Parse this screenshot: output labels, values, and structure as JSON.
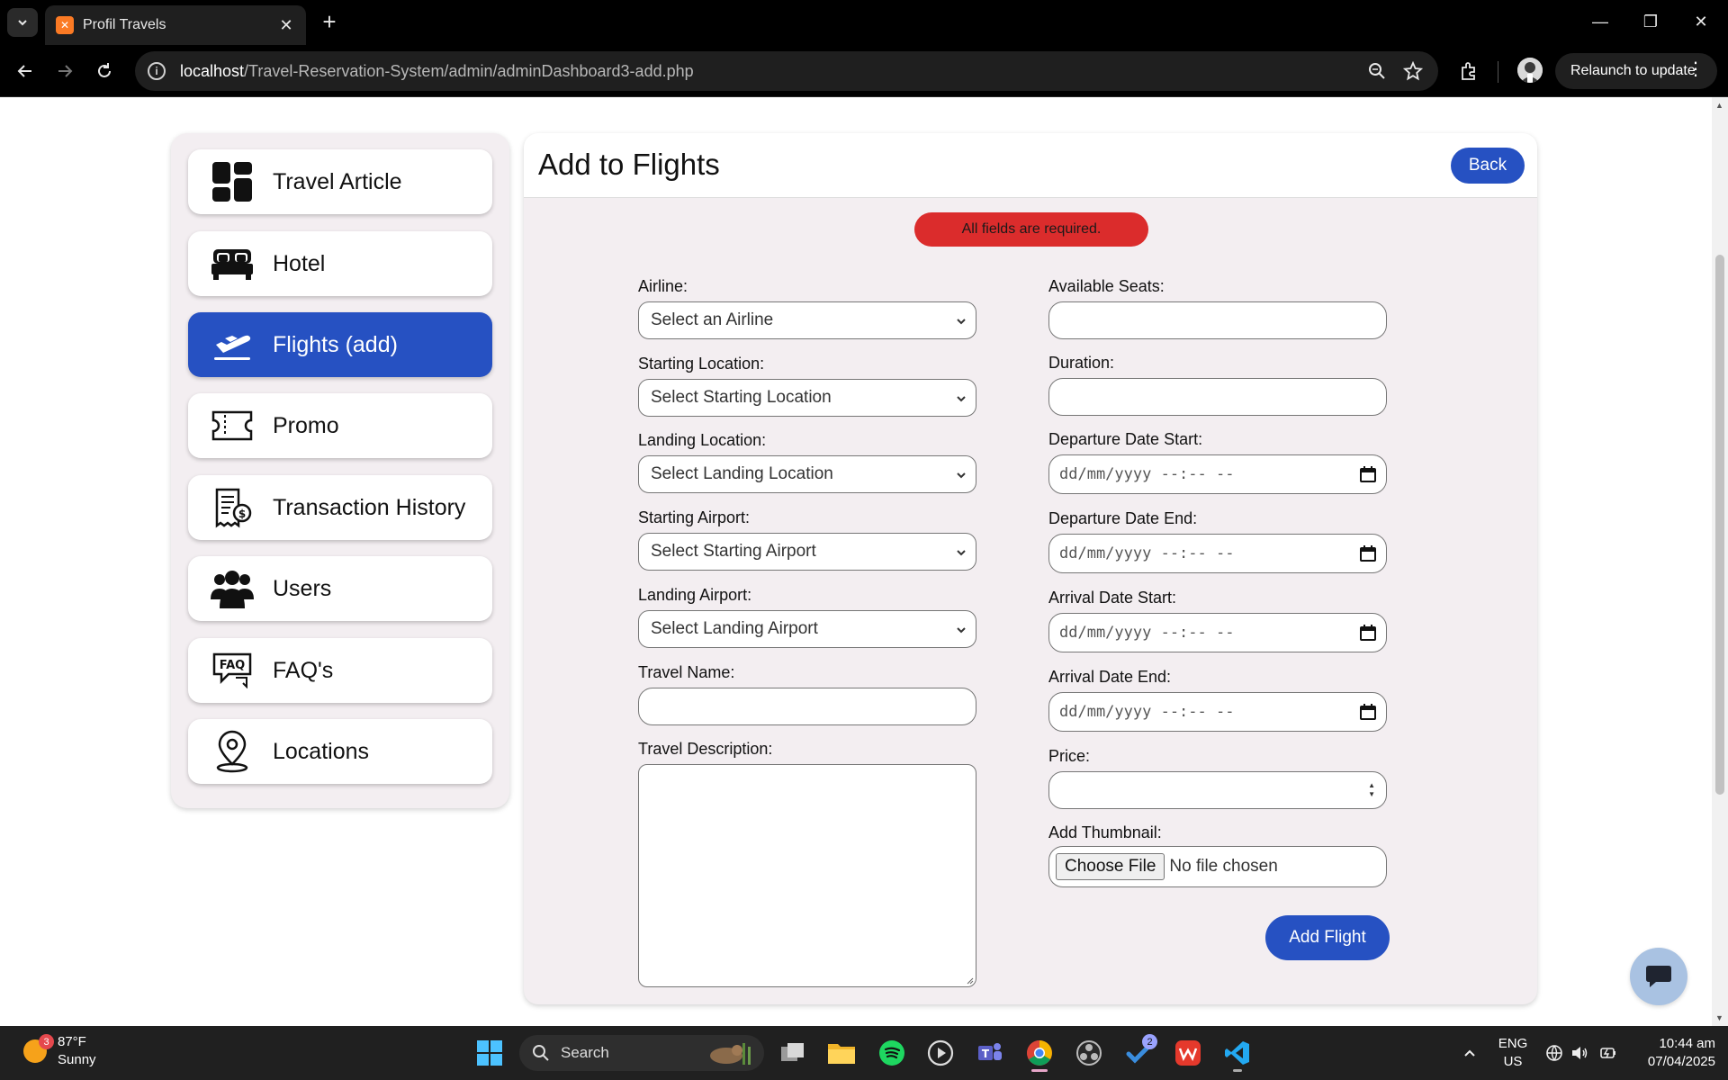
{
  "browser": {
    "tab_title": "Profil Travels",
    "url_host": "localhost",
    "url_path": "/Travel-Reservation-System/admin/adminDashboard3-add.php",
    "relaunch_label": "Relaunch to update"
  },
  "sidebar": {
    "items": [
      {
        "label": "Travel Article",
        "icon": "dashboard-icon"
      },
      {
        "label": "Hotel",
        "icon": "bed-icon"
      },
      {
        "label": "Flights (add)",
        "icon": "plane-departure-icon",
        "active": true
      },
      {
        "label": "Promo",
        "icon": "ticket-icon"
      },
      {
        "label": "Transaction History",
        "icon": "receipt-icon"
      },
      {
        "label": "Users",
        "icon": "users-icon"
      },
      {
        "label": "FAQ's",
        "icon": "faq-icon"
      },
      {
        "label": "Locations",
        "icon": "location-pin-icon"
      }
    ]
  },
  "main": {
    "title": "Add to Flights",
    "back_label": "Back",
    "alert": "All fields are required.",
    "left": {
      "airline_label": "Airline:",
      "airline_value": "Select an Airline",
      "start_loc_label": "Starting Location:",
      "start_loc_value": "Select Starting Location",
      "land_loc_label": "Landing Location:",
      "land_loc_value": "Select Landing Location",
      "start_airport_label": "Starting Airport:",
      "start_airport_value": "Select Starting Airport",
      "land_airport_label": "Landing Airport:",
      "land_airport_value": "Select Landing Airport",
      "travel_name_label": "Travel Name:",
      "travel_desc_label": "Travel Description:"
    },
    "right": {
      "seats_label": "Available Seats:",
      "duration_label": "Duration:",
      "dep_start_label": "Departure Date Start:",
      "dep_end_label": "Departure Date End:",
      "arr_start_label": "Arrival Date Start:",
      "arr_end_label": "Arrival Date End:",
      "date_placeholder": "dd/mm/yyyy --:-- --",
      "price_label": "Price:",
      "thumb_label": "Add Thumbnail:",
      "choose_file": "Choose File",
      "no_file": "No file chosen"
    },
    "submit_label": "Add Flight"
  },
  "taskbar": {
    "weather_badge": "3",
    "temperature": "87°F",
    "condition": "Sunny",
    "search_label": "Search",
    "todo_badge": "2",
    "lang_1": "ENG",
    "lang_2": "US",
    "time": "10:44 am",
    "date": "07/04/2025"
  },
  "colors": {
    "accent": "#2651c2",
    "alert": "#db2c2c",
    "panel": "#f3eef1"
  }
}
